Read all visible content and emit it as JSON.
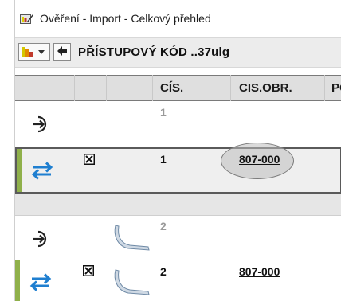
{
  "window": {
    "title": "Ověření - Import - Celkový přehled"
  },
  "toolbar": {
    "title": "PŘÍSTUPOVÝ KÓD ..37ulg"
  },
  "columns": {
    "cis": "CÍS.",
    "cisobr": "CIS.OBR.",
    "p": "PO"
  },
  "rows": [
    {
      "number": "1",
      "code": ""
    },
    {
      "number": "1",
      "code": "807-000"
    },
    {
      "number": "2",
      "code": ""
    },
    {
      "number": "2",
      "code": "807-000"
    }
  ],
  "colors": {
    "accent": "#8fb04a",
    "sync_icon": "#1f7fd0"
  }
}
